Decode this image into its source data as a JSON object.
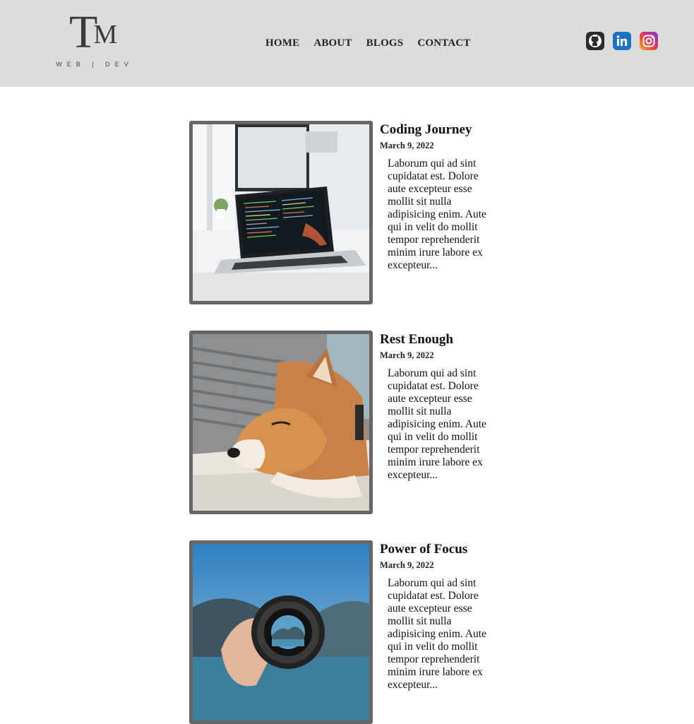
{
  "header": {
    "logo": {
      "mark_t": "T",
      "mark_m": "M",
      "subtitle": "WEB | DEV"
    },
    "nav": [
      {
        "label": "HOME"
      },
      {
        "label": "ABOUT"
      },
      {
        "label": "BLOGS"
      },
      {
        "label": "CONTACT"
      }
    ],
    "socials": [
      {
        "icon": "github-icon"
      },
      {
        "icon": "linkedin-icon"
      },
      {
        "icon": "instagram-icon"
      }
    ]
  },
  "posts": [
    {
      "title": "Coding Journey",
      "date": "March 9, 2022",
      "excerpt": "Laborum qui ad sint cupidatat est. Dolore aute excepteur esse mollit sit nulla adipisicing enim. Aute qui in velit do mollit tempor reprehenderit minim irure labore ex excepteur...",
      "image": "laptop-code-photo"
    },
    {
      "title": "Rest Enough",
      "date": "March 9, 2022",
      "excerpt": "Laborum qui ad sint cupidatat est. Dolore aute excepteur esse mollit sit nulla adipisicing enim. Aute qui in velit do mollit tempor reprehenderit minim irure labore ex excepteur...",
      "image": "sleeping-dog-photo"
    },
    {
      "title": "Power of Focus",
      "date": "March 9, 2022",
      "excerpt": "Laborum qui ad sint cupidatat est. Dolore aute excepteur esse mollit sit nulla adipisicing enim. Aute qui in velit do mollit tempor reprehenderit minim irure labore ex excepteur...",
      "image": "camera-lens-photo"
    }
  ],
  "colors": {
    "header_bg": "#dcdcdc",
    "frame": "#666666",
    "linkedin": "#1b74c2"
  }
}
